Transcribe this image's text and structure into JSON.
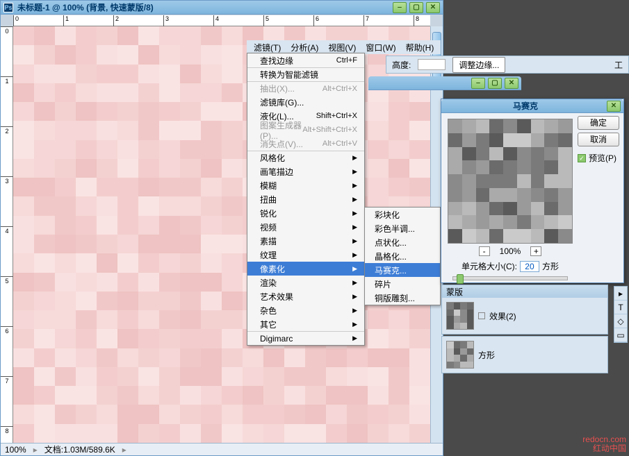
{
  "doc_title": "未标题-1 @ 100% (背景, 快速蒙版/8)",
  "ruler_h": [
    "0",
    "1",
    "2",
    "3",
    "4",
    "5",
    "6",
    "7",
    "8"
  ],
  "ruler_v": [
    "0",
    "1",
    "2",
    "3",
    "4",
    "5",
    "6",
    "7",
    "8"
  ],
  "status": {
    "zoom": "100%",
    "docinfo": "文档:1.03M/589.6K"
  },
  "menubar": [
    "滤镜(T)",
    "分析(A)",
    "视图(V)",
    "窗口(W)",
    "帮助(H)"
  ],
  "menu": [
    {
      "label": "查找边缘",
      "sc": "Ctrl+F",
      "sep": false
    },
    {
      "label": "转换为智能滤镜",
      "sep": true
    },
    {
      "label": "抽出(X)...",
      "sc": "Alt+Ctrl+X",
      "sep": true,
      "dis": true
    },
    {
      "label": "滤镜库(G)..."
    },
    {
      "label": "液化(L)...",
      "sc": "Shift+Ctrl+X"
    },
    {
      "label": "图案生成器(P)...",
      "sc": "Alt+Shift+Ctrl+X",
      "dis": true
    },
    {
      "label": "消失点(V)...",
      "sc": "Alt+Ctrl+V",
      "dis": true
    },
    {
      "label": "风格化",
      "sep": true,
      "sub": true
    },
    {
      "label": "画笔描边",
      "sub": true
    },
    {
      "label": "模糊",
      "sub": true
    },
    {
      "label": "扭曲",
      "sub": true
    },
    {
      "label": "锐化",
      "sub": true
    },
    {
      "label": "视频",
      "sub": true
    },
    {
      "label": "素描",
      "sub": true
    },
    {
      "label": "纹理",
      "sub": true
    },
    {
      "label": "像素化",
      "sub": true,
      "hl": true
    },
    {
      "label": "渲染",
      "sub": true
    },
    {
      "label": "艺术效果",
      "sub": true
    },
    {
      "label": "杂色",
      "sub": true
    },
    {
      "label": "其它",
      "sub": true
    },
    {
      "label": "Digimarc",
      "sep": true,
      "sub": true
    }
  ],
  "submenu": [
    {
      "label": "彩块化"
    },
    {
      "label": "彩色半调..."
    },
    {
      "label": "点状化..."
    },
    {
      "label": "晶格化..."
    },
    {
      "label": "马赛克...",
      "hl": true
    },
    {
      "label": "碎片"
    },
    {
      "label": "铜版雕刻..."
    }
  ],
  "optionbar": {
    "height_lbl": "高度:",
    "refine": "调整边缘...",
    "toolico": "工"
  },
  "dialog": {
    "title": "马赛克",
    "ok": "确定",
    "cancel": "取消",
    "preview": "预览(P)",
    "zoom": "100%",
    "zminus": "-",
    "zplus": "+",
    "cell_label": "单元格大小(C):",
    "cell_value": "20",
    "unit": "方形"
  },
  "panels": {
    "mask": "蒙版",
    "layer_bg": "效果(2)",
    "layer_unit": "方形"
  },
  "watermark": {
    "l1": "redocn.com",
    "l2": "红动中国"
  }
}
